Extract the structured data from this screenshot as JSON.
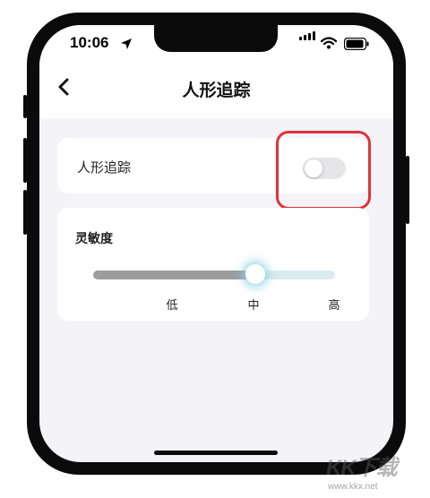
{
  "status_bar": {
    "time": "10:06"
  },
  "nav": {
    "title": "人形追踪"
  },
  "tracking_row": {
    "label": "人形追踪",
    "enabled": false
  },
  "sensitivity": {
    "label": "灵敏度",
    "ticks": [
      "低",
      "中",
      "高"
    ],
    "selected": "中",
    "level_fraction": 0.67
  },
  "watermark": {
    "logo": "KK下载",
    "url": "www.kkx.net"
  },
  "colors": {
    "highlight": "#e0323a",
    "track_active": "#9d9d9d",
    "track_inactive": "#d9ebef"
  }
}
